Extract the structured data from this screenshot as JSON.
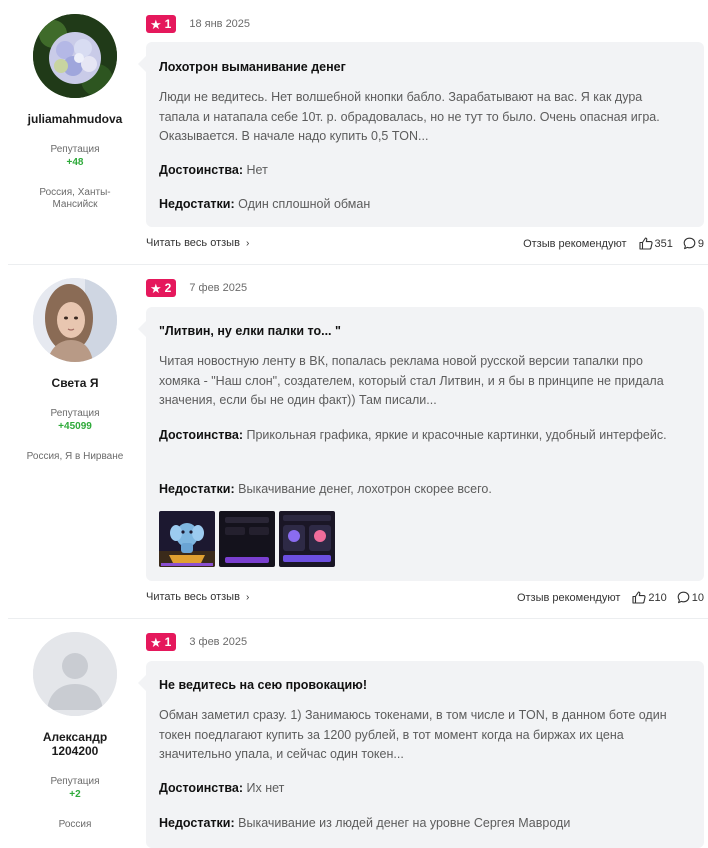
{
  "reviews": [
    {
      "author": "juliamahmudova",
      "rep_label": "Репутация",
      "rep_value": "+48",
      "location": "Россия, Ханты-Мансийск",
      "rating": "1",
      "date": "18 янв 2025",
      "title": "Лохотрон выманивание денег",
      "body": "Люди не ведитесь. Нет волшебной кнопки бабло. Зарабатывают на вас. Я как дура тапала и натапала себе 10т. р. обрадовалась, но не тут то было. Очень опасная игра. Оказывается. В начале надо купить 0,5 TON...",
      "pros_label": "Достоинства:",
      "pros": "Нет",
      "cons_label": "Недостатки:",
      "cons": "Один сплошной обман",
      "read_more": "Читать весь отзыв",
      "recommend": "Отзыв рекомендуют",
      "likes": "351",
      "comments": "9",
      "avatar_icon": "hydrangea-photo"
    },
    {
      "author": "Света Я",
      "rep_label": "Репутация",
      "rep_value": "+45099",
      "location": "Россия, Я в Нирване",
      "rating": "2",
      "date": "7 фев 2025",
      "title": "\"Литвин, ну елки палки то... \"",
      "body": "Читая новостную ленту в ВК, попалась реклама новой русской версии тапалки про хомяка - \"Наш слон\", создателем, который стал Литвин, и я бы в принципе не придала значения, если бы не один факт)) Там писали...",
      "pros_label": "Достоинства:",
      "pros": "Прикольная графика, яркие и красочные картинки, удобный интерфейс.",
      "cons_label": "Недостатки:",
      "cons": "Выкачивание денег, лохотрон скорее всего.",
      "read_more": "Читать весь отзыв",
      "recommend": "Отзыв рекомендуют",
      "likes": "210",
      "comments": "10",
      "avatar_icon": "woman-portrait-photo",
      "thumbnails": [
        "elephant-game-screenshot",
        "dark-app-screenshot",
        "ton-wallet-screenshot"
      ]
    },
    {
      "author": "Александр 1204200",
      "rep_label": "Репутация",
      "rep_value": "+2",
      "location": "Россия",
      "rating": "1",
      "date": "3 фев 2025",
      "title": "Не ведитесь на сею провокацию!",
      "body": "Обман заметил сразу. 1) Занимаюсь токенами, в том числе и TON, в данном боте один токен поедлагают купить за 1200 рублей, в тот момент когда на биржах их цена значительно упала, и сейчас один токен...",
      "pros_label": "Достоинства:",
      "pros": "Их нет",
      "cons_label": "Недостатки:",
      "cons": "Выкачивание из людей денег на уровне Сергея Мавроди",
      "avatar_icon": "default-user-icon"
    }
  ],
  "colors": {
    "badge": "#e5185c",
    "reputation": "#2eaa3a",
    "card_bg": "#f2f3f5"
  }
}
